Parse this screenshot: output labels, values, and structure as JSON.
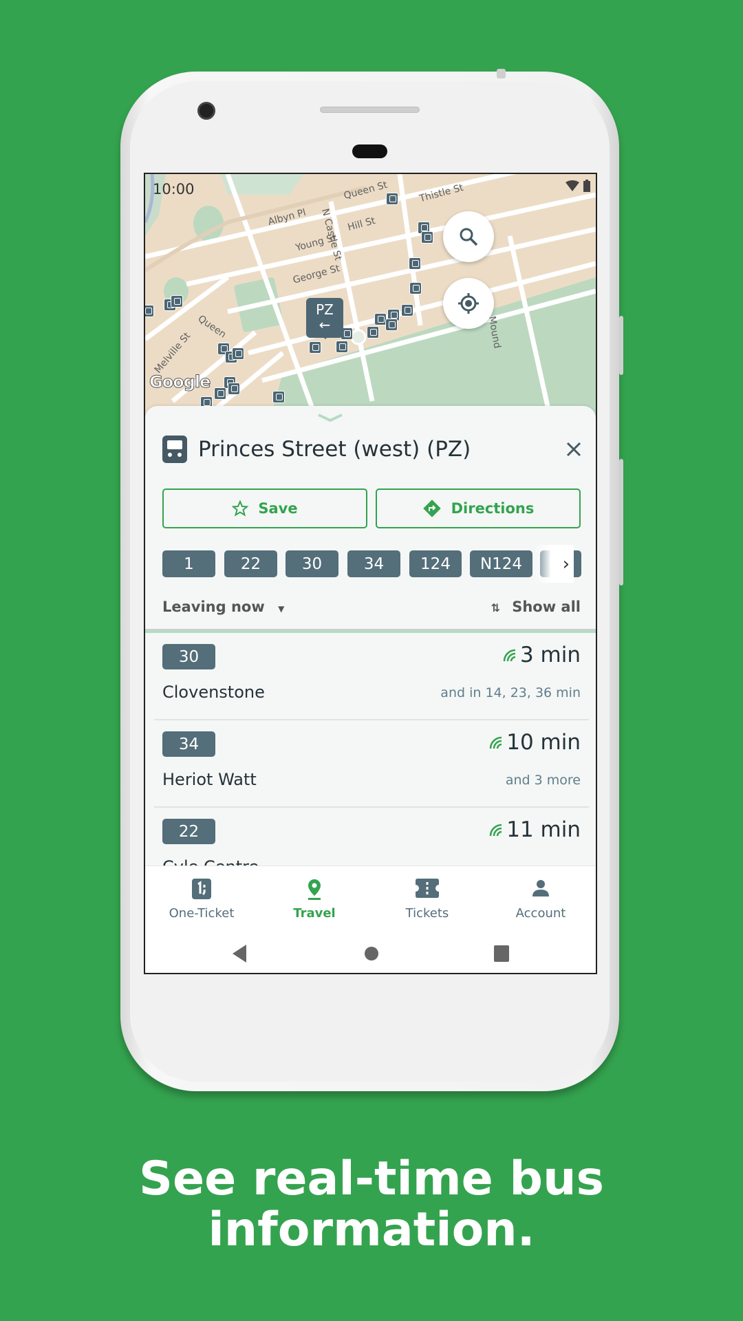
{
  "status_bar": {
    "time": "10:00"
  },
  "map": {
    "street_labels": [
      "Queen St",
      "Thistle St",
      "Albyn Pl",
      "N Castle St",
      "Hill St",
      "Young St",
      "George St",
      "Melville St",
      "Queen",
      "Mound"
    ],
    "stop_marker": {
      "code": "PZ",
      "arrow": "←"
    },
    "attribution": "Google",
    "search_icon": "search-icon",
    "locate_icon": "my-location-icon"
  },
  "stop": {
    "name": "Princes Street (west) (PZ)",
    "save_label": "Save",
    "directions_label": "Directions",
    "routes": [
      "1",
      "22",
      "30",
      "34",
      "124",
      "N124",
      "N"
    ],
    "time_filter": "Leaving now",
    "show_all_label": "Show all"
  },
  "departures": [
    {
      "route": "30",
      "destination": "Clovenstone",
      "eta": "3 min",
      "more": "and in 14, 23, 36 min"
    },
    {
      "route": "34",
      "destination": "Heriot Watt",
      "eta": "10 min",
      "more": "and 3 more"
    },
    {
      "route": "22",
      "destination": "Cyle Centre",
      "eta": "11 min"
    }
  ],
  "bottom_nav": {
    "items": [
      {
        "label": "One-Ticket",
        "active": false
      },
      {
        "label": "Travel",
        "active": true
      },
      {
        "label": "Tickets",
        "active": false
      },
      {
        "label": "Account",
        "active": false
      }
    ]
  },
  "colors": {
    "brand_green": "#34a34f",
    "chip": "#546e7a",
    "text": "#263238"
  },
  "caption": {
    "line1": "See real-time bus",
    "line2": "information."
  }
}
